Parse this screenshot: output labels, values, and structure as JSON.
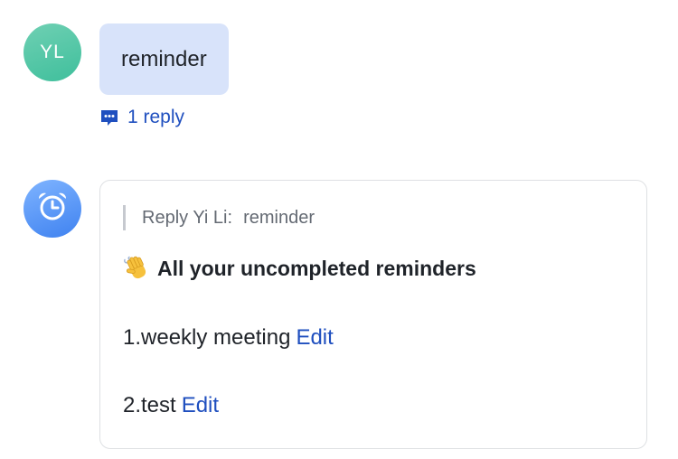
{
  "thread": {
    "user_message": {
      "avatar_initials": "YL",
      "text": "reminder",
      "reply_count_label": "1 reply"
    },
    "bot_message": {
      "avatar_icon": "alarm-clock-icon",
      "quote": {
        "prefix": "Reply Yi Li:",
        "text": "reminder"
      },
      "headline_icon": "waving-hand-icon",
      "headline": "All your uncompleted reminders",
      "reminders": [
        {
          "text": "1.weekly meeting",
          "action_label": "Edit"
        },
        {
          "text": "2.test",
          "action_label": "Edit"
        }
      ]
    }
  },
  "colors": {
    "user_avatar": "#3fbf9c",
    "user_bubble": "#d8e3fa",
    "bot_avatar": "#3f82f0",
    "link": "#1f4fbf",
    "card_border": "#dee0e3",
    "quote_text": "#646a73"
  }
}
